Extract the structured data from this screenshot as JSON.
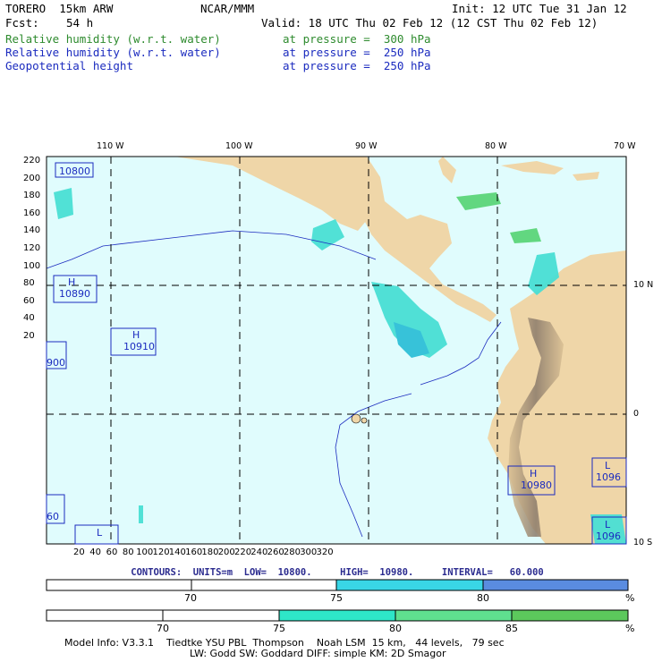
{
  "header": {
    "model": "TORERO  15km ARW",
    "center": "NCAR/MMM",
    "init": "Init: 12 UTC Tue 31 Jan 12",
    "fcst_label": "Fcst:",
    "fcst_value": "54 h",
    "valid": "Valid: 18 UTC Thu 02 Feb 12 (12 CST Thu 02 Feb 12)"
  },
  "fields": [
    {
      "name": "Relative humidity (w.r.t. water)",
      "level": "at pressure =  300 hPa",
      "color": "#2e8b2e"
    },
    {
      "name": "Relative humidity (w.r.t. water)",
      "level": "at pressure =  250 hPa",
      "color": "#1b2bbf"
    },
    {
      "name": "Geopotential height",
      "level": "at pressure =  250 hPa",
      "color": "#1b2bbf"
    }
  ],
  "map": {
    "top_lon_labels": [
      "110 W",
      "100 W",
      "90 W",
      "80 W",
      "70 W"
    ],
    "right_lat_labels": [
      "10 N",
      "0",
      "10 S"
    ],
    "left_ticks": [
      "220",
      "200",
      "180",
      "160",
      "140",
      "120",
      "100",
      "80",
      "60",
      "40",
      "20"
    ],
    "bottom_ticks": [
      "20",
      "40",
      "60",
      "80",
      "100",
      "120",
      "140",
      "160",
      "180",
      "200",
      "220",
      "240",
      "260",
      "280",
      "300",
      "320"
    ],
    "pressure_labels": [
      {
        "letter": "",
        "value": "10800"
      },
      {
        "letter": "H",
        "value": "10890"
      },
      {
        "letter": "H",
        "value": "10910"
      },
      {
        "letter": "",
        "value": "900"
      },
      {
        "letter": "",
        "value": "60"
      },
      {
        "letter": "L",
        "value": ""
      },
      {
        "letter": "H",
        "value": "10980"
      },
      {
        "letter": "L",
        "value": "1096"
      },
      {
        "letter": "L",
        "value": "1096"
      }
    ],
    "colors": {
      "ocean": "#e0fcfd",
      "land": "#efd6a8",
      "mountain": "#8a7a6a",
      "rh_light": "#49dfd4",
      "rh_green": "#5cd67a",
      "rh_blue": "#5a8ce0"
    }
  },
  "contours_text": "CONTOURS:  UNITS=m  LOW=  10800.     HIGH=  10980.     INTERVAL=   60.000",
  "colorbar1": {
    "ticks": [
      "70",
      "75",
      "80"
    ],
    "unit": "%",
    "colors": [
      "#ffffff",
      "#ffffff",
      "#39d6e6",
      "#5a8ce0"
    ]
  },
  "colorbar2": {
    "ticks": [
      "70",
      "75",
      "80",
      "85"
    ],
    "unit": "%",
    "colors": [
      "#ffffff",
      "#ffffff",
      "#2ee6c8",
      "#5fe08f",
      "#5cc85c"
    ]
  },
  "footer": {
    "line1": "Model Info: V3.3.1    Tiedtke YSU PBL  Thompson    Noah LSM  15 km,   44 levels,   79 sec",
    "line2": "LW: Godd SW: Goddard DIFF: simple KM: 2D Smagor"
  }
}
